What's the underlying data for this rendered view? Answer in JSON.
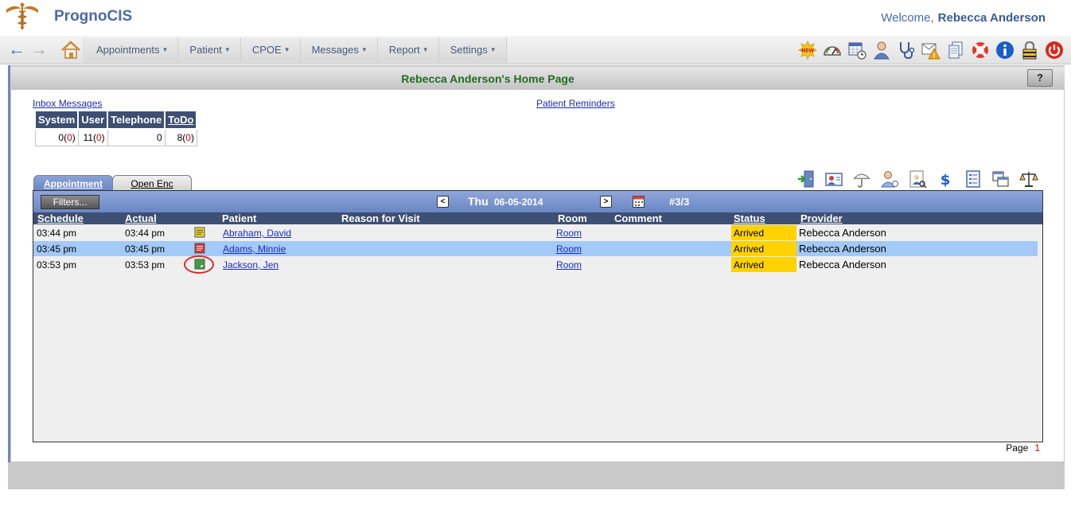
{
  "app": {
    "title": "PrognoCIS",
    "welcome_prefix": "Welcome,",
    "user_name": "Rebecca Anderson"
  },
  "menu": [
    {
      "label": "Appointments"
    },
    {
      "label": "Patient"
    },
    {
      "label": "CPOE"
    },
    {
      "label": "Messages"
    },
    {
      "label": "Report"
    },
    {
      "label": "Settings"
    }
  ],
  "toolbar_icons": [
    "new-icon",
    "dashboard-gauge-icon",
    "calendar-clock-icon",
    "user-icon",
    "stethoscope-icon",
    "alert-mail-icon",
    "documents-icon",
    "lifebuoy-icon",
    "info-icon",
    "lock-icon",
    "power-icon"
  ],
  "page": {
    "title": "Rebecca Anderson's Home Page",
    "help_label": "?"
  },
  "inbox": {
    "link": "Inbox Messages",
    "headers": [
      "System",
      "User",
      "Telephone",
      "ToDo"
    ],
    "values": [
      {
        "count": "0",
        "unread": "0"
      },
      {
        "count": "11",
        "unread": "0"
      },
      {
        "count": "0",
        "unread": ""
      },
      {
        "count": "8",
        "unread": "0"
      }
    ]
  },
  "reminders_link": "Patient Reminders",
  "tabs": {
    "appointment": "Appointment",
    "open_enc": "Open Enc"
  },
  "appointments": {
    "filters_label": "Filters...",
    "prev": "<",
    "next": ">",
    "day": "Thu",
    "date": "06-05-2014",
    "count": "#3/3",
    "columns": [
      "Schedule",
      "Actual",
      "Patient",
      "Reason for Visit",
      "Room",
      "Comment",
      "Status",
      "Provider"
    ],
    "rows": [
      {
        "schedule": "03:44 pm",
        "actual": "03:44 pm",
        "patient": "Abraham, David",
        "reason": "",
        "room": "Room",
        "comment": "",
        "status": "Arrived",
        "provider": "Rebecca Anderson",
        "note_color": "#e9d12a"
      },
      {
        "schedule": "03:45 pm",
        "actual": "03:45 pm",
        "patient": "Adams, Minnie",
        "reason": "",
        "room": "Room",
        "comment": "",
        "status": "Arrived",
        "provider": "Rebecca Anderson",
        "note_color": "#d83030"
      },
      {
        "schedule": "03:53 pm",
        "actual": "03:53 pm",
        "patient": "Jackson, Jen",
        "reason": "",
        "room": "Room",
        "comment": "",
        "status": "Arrived",
        "provider": "Rebecca Anderson",
        "note_color": "#3aa23a"
      }
    ],
    "page_label": "Page",
    "page_number": "1"
  },
  "colors": {
    "brand": "#4a6aa8",
    "header_bar": "#3d4f72",
    "status_arrived": "#ffd200",
    "row_selected": "#a3c9f7",
    "page_title": "#236b23"
  }
}
